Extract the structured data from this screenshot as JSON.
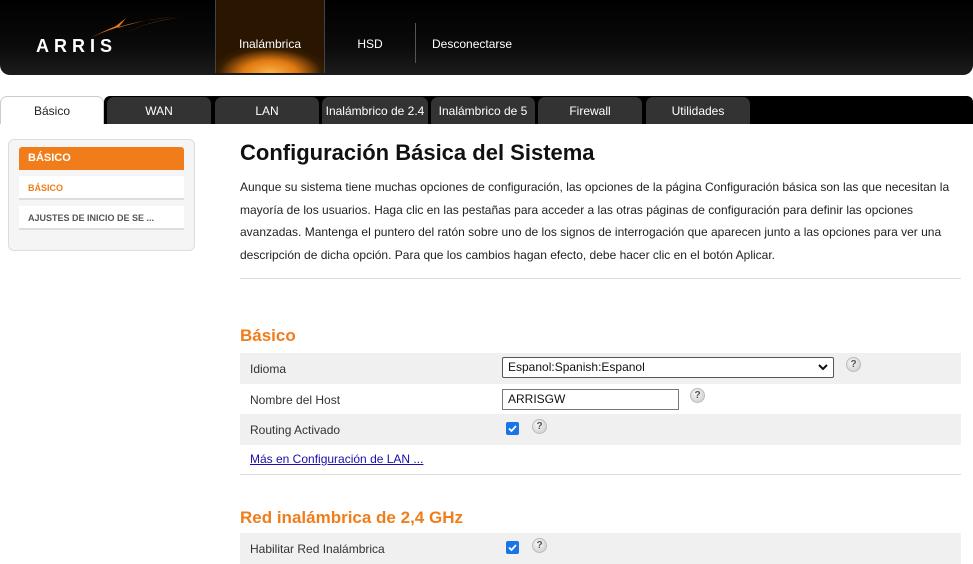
{
  "brand": {
    "logo_text": "ARRIS"
  },
  "topnav": {
    "items": [
      "Inalámbrica",
      "HSD",
      "Desconectarse"
    ]
  },
  "tabs": [
    "Básico",
    "WAN",
    "LAN",
    "Inalámbrico de 2.4",
    "Inalámbrico de 5",
    "Firewall",
    "Utilidades"
  ],
  "sidebar": {
    "heading": "BÁSICO",
    "items": [
      "BÁSICO",
      "AJUSTES DE INICIO DE SE ..."
    ]
  },
  "main": {
    "title": "Configuración Básica del Sistema",
    "intro": "Aunque su sistema tiene muchas opciones de configuración, las opciones de la página Configuración básica son las que necesitan la mayoría de los usuarios. Haga clic en las pestañas para acceder a las otras páginas de configuración para definir las opciones avanzadas. Mantenga el puntero del ratón sobre uno de los signos de interrogación que aparecen junto a las opciones para ver una descripción de dicha opción. Para que los cambios hagan efecto, debe hacer clic en el botón Aplicar."
  },
  "basic_section": {
    "title": "Básico",
    "language_label": "Idioma",
    "language_value": "Espanol:Spanish:Espanol",
    "hostname_label": "Nombre del Host",
    "hostname_value": "ARRISGW",
    "routing_label": "Routing Activado",
    "routing_enabled": true,
    "lan_link": "Más en Configuración de LAN ..."
  },
  "wireless24_section": {
    "title": "Red inalámbrica de 2,4 GHz",
    "enable_label": "Habilitar Red Inalámbrica",
    "enable_checked": true
  },
  "help_glyph": "?",
  "colors": {
    "accent": "#f07d1a",
    "checkbox": "#1a73e8",
    "link": "#1a0dab"
  }
}
